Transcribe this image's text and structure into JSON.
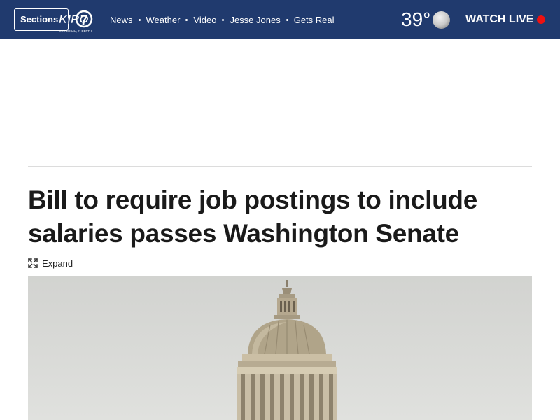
{
  "header": {
    "sections_label": "Sections",
    "logo_text": "KIRO",
    "logo_number": "7",
    "logo_tagline": "LIVE LOCAL, IN DEPTH",
    "nav_items": [
      "News",
      "Weather",
      "Video",
      "Jesse Jones",
      "Gets Real"
    ],
    "temperature": "39°",
    "weather_icon": "cloudy-icon",
    "watch_live_label": "WATCH LIVE",
    "colors": {
      "bar": "#203a6e",
      "live_dot": "#ee1111"
    }
  },
  "article": {
    "headline": "Bill to require job postings to include salaries passes Washington Senate",
    "expand_label": "Expand",
    "photo_subject": "capitol-dome-image"
  }
}
